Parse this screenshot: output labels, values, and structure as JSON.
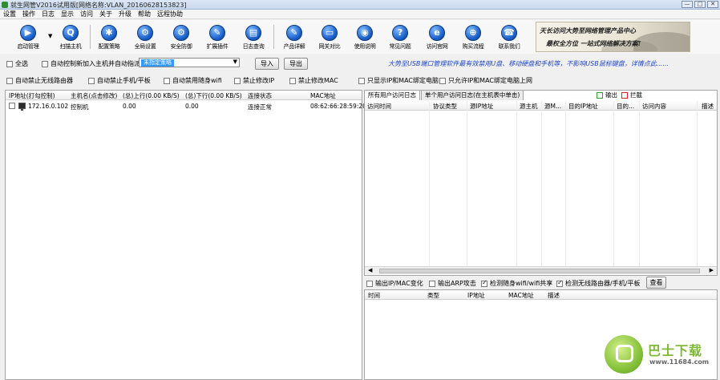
{
  "window": {
    "title": "就生网管V2016试用版[网络名称:VLAN_20160628153823]",
    "controls": [
      "—",
      "□",
      "✕"
    ]
  },
  "menu": [
    "设置",
    "操作",
    "日志",
    "显示",
    "访问",
    "关于",
    "升级",
    "帮助",
    "远程协助"
  ],
  "toolbar": {
    "items": [
      {
        "label": "启动管理",
        "icon": "play-icon",
        "glyph": "▶"
      },
      {
        "label": "扫描主机",
        "icon": "search-icon",
        "glyph": "Q"
      },
      {
        "label": "配置策略",
        "icon": "gears-icon",
        "glyph": "✱"
      },
      {
        "label": "全局设置",
        "icon": "settings-icon",
        "glyph": "⚙"
      },
      {
        "label": "安全防御",
        "icon": "shield-icon",
        "glyph": "⚙"
      },
      {
        "label": "扩展插件",
        "icon": "wrench-icon",
        "glyph": "✎"
      },
      {
        "label": "日志查询",
        "icon": "log-icon",
        "glyph": "▤"
      },
      {
        "label": "产品详解",
        "icon": "pencil-icon",
        "glyph": "✎"
      },
      {
        "label": "网关对比",
        "icon": "compare-icon",
        "glyph": "▭"
      },
      {
        "label": "使用说明",
        "icon": "help-icon",
        "glyph": "◉"
      },
      {
        "label": "常见问题",
        "icon": "question-icon",
        "glyph": "?"
      },
      {
        "label": "访问官网",
        "icon": "globe-icon",
        "glyph": "e"
      },
      {
        "label": "购买流程",
        "icon": "cart-icon",
        "glyph": "⊕"
      },
      {
        "label": "联系我们",
        "icon": "contact-icon",
        "glyph": "☎"
      }
    ],
    "dropdown_arrow": "▼"
  },
  "banner": {
    "line1": "天长访问大势至网络管理产品中心",
    "line2": "最权全方位 一站式网络解决方案!"
  },
  "controls": {
    "select_all": "全选",
    "auto_control_new": "自动控制新加入主机并自动指派",
    "policy_value": "未指定策略",
    "import_label": "导入",
    "export_label": "导出",
    "notice": "大势至USB端口管理软件最有效禁用U盘、移动硬盘和手机等，不影响USB鼠标键盘，详情点此......"
  },
  "options": [
    {
      "label": "自动禁止无线路由器",
      "checked": false
    },
    {
      "label": "自动禁止手机/平板",
      "checked": false
    },
    {
      "label": "自动禁用随身wifi",
      "checked": false
    },
    {
      "label": "禁止修改IP",
      "checked": false
    },
    {
      "label": "禁止修改MAC",
      "checked": false
    },
    {
      "label": "只显示IP和MAC绑定电脑",
      "checked": false
    },
    {
      "label": "只允许IP和MAC绑定电脑上网",
      "checked": false
    }
  ],
  "hosts": {
    "columns": [
      "IP地址(打勾控制)",
      "主机名(点击修改)",
      "(总)上行(0.00 KB/S)",
      "(总)下行(0.00 KB/S)",
      "连接状态",
      "MAC地址"
    ],
    "rows": [
      {
        "checked": false,
        "ip": "172.16.0.102",
        "name": "控制机",
        "up": "0.00",
        "down": "0.00",
        "status": "连接正常",
        "mac": "08:62:66:28:59:20"
      }
    ]
  },
  "log": {
    "tabs": [
      "所有用户访问日志",
      "单个用户访问日志(在主机表中单击)"
    ],
    "legend": [
      {
        "label": "输出",
        "color": "#2e9e2e"
      },
      {
        "label": "拦截",
        "color": "#e02020"
      }
    ],
    "columns": [
      "访问时间",
      "协议类型",
      "源IP地址",
      "源主机",
      "源M...",
      "目的IP地址",
      "目的...",
      "访问内容",
      "描述"
    ]
  },
  "alerts": {
    "options": [
      {
        "label": "输出IP/MAC变化",
        "checked": false
      },
      {
        "label": "输出ARP攻击",
        "checked": false
      },
      {
        "label": "检测随身wifi/wifi共享",
        "checked": true
      },
      {
        "label": "检测无线路由器/手机/平板",
        "checked": true
      }
    ],
    "view_button": "查看",
    "columns": [
      "时间",
      "类型",
      "IP地址",
      "MAC地址",
      "描述"
    ]
  },
  "watermark": {
    "brand": "巴士下载",
    "url": "www.11684.com"
  }
}
